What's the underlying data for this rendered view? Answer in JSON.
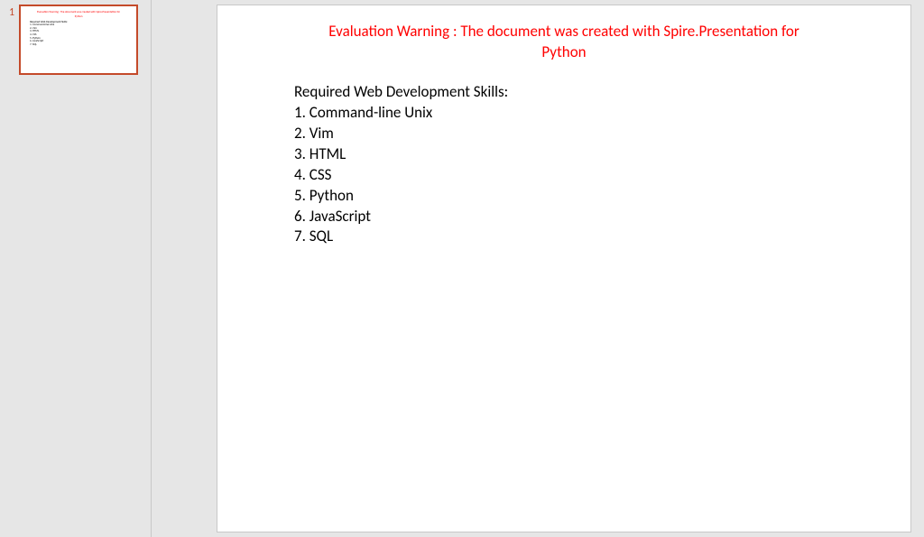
{
  "thumbnail": {
    "number": "1"
  },
  "warning": {
    "line1": "Evaluation Warning : The document was created with Spire.Presentation for",
    "line2": "Python"
  },
  "content": {
    "title": "Required Web Development Skills:",
    "items": [
      "1. Command-line Unix",
      "2. Vim",
      "3. HTML",
      "4. CSS",
      "5. Python",
      "6. JavaScript",
      "7. SQL"
    ]
  }
}
